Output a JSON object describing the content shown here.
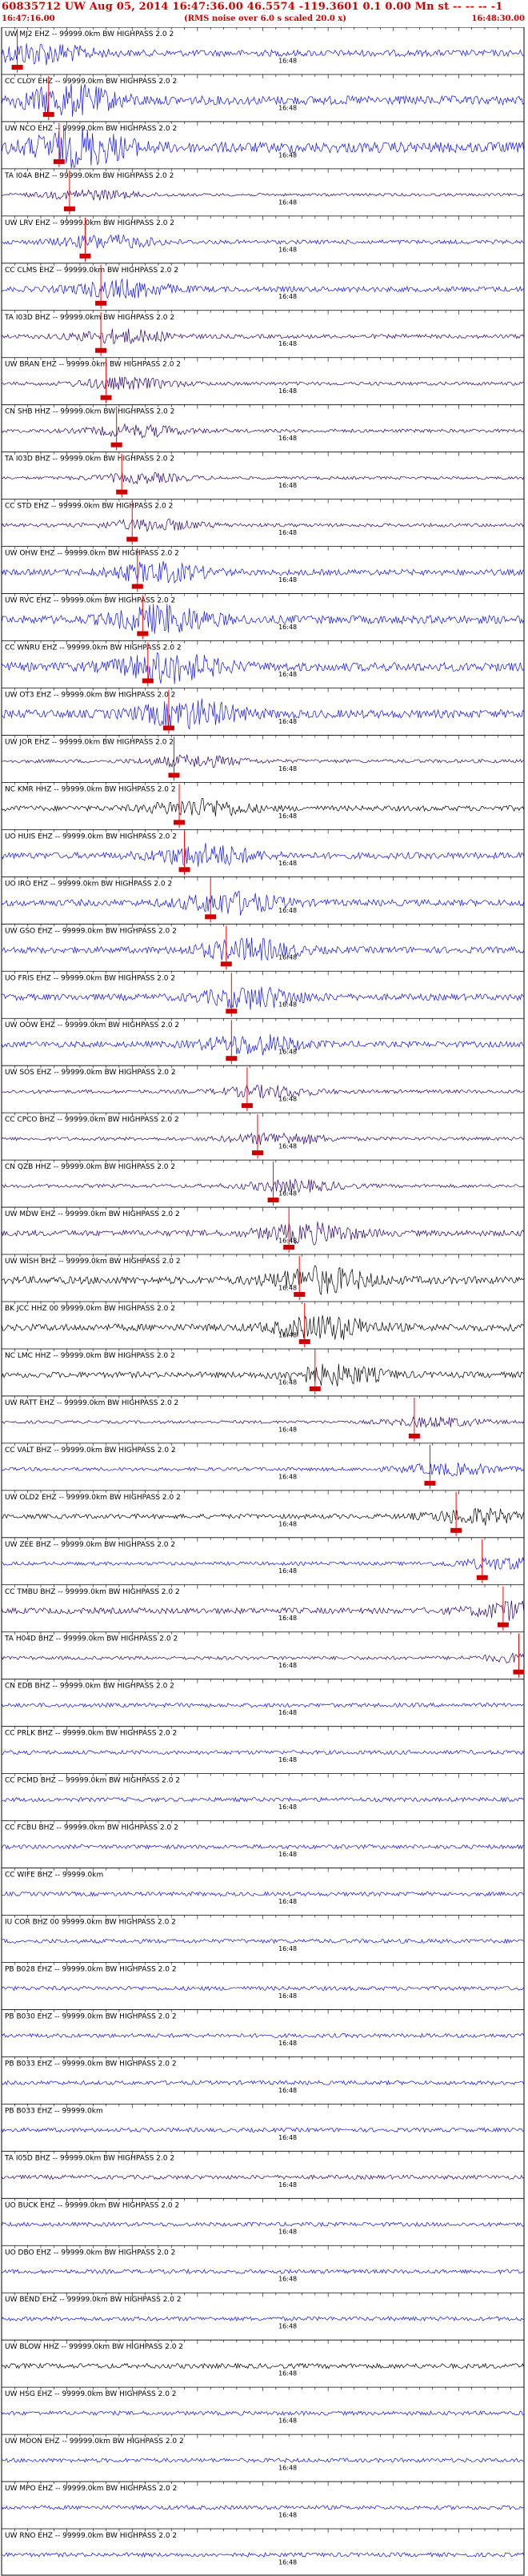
{
  "header": {
    "event_line": "60835712 UW Aug 05, 2014 16:47:36.00    46.5574 -119.3601   0.1 0.00 Mn st -- -- -- -1",
    "start_time": "16:47:16.00",
    "noise_note": "(RMS noise over 6.0 s scaled 20.0 x)",
    "end_time": "16:48:30.00"
  },
  "colors": {
    "trace_blue": "#1010ee",
    "trace_purple": "#2a0070",
    "trace_black": "#000000",
    "pick_red": "#ff0000",
    "pick_box": "#cc0000"
  },
  "chart_data": {
    "type": "line",
    "title": "60835712 UW Aug 05, 2014 16:47:36.00    46.5574 -119.3601   0.1 0.00 Mn st -- -- -- -1",
    "xlabel": "",
    "ylabel": "",
    "x_range": [
      "16:47:16.00",
      "16:48:30.00"
    ],
    "tick_label": "16:48",
    "channels": [
      {
        "name": "UW MJ2 EHZ -- 99999.0km BW  HIGHPASS  2.0  2",
        "color": "#1010ee",
        "amp": 0.55,
        "pick": 0.03
      },
      {
        "name": "CC CLOY EHZ -- 99999.0km BW  HIGHPASS  2.0  2",
        "color": "#1010ee",
        "amp": 0.75,
        "pick": 0.09
      },
      {
        "name": "UW NCO EHZ -- 99999.0km BW  HIGHPASS  2.0  2",
        "color": "#1010ee",
        "amp": 0.9,
        "pick": 0.11
      },
      {
        "name": "TA I04A BHZ -- 99999.0km BW  HIGHPASS  2.0  2",
        "color": "#2a0070",
        "amp": 0.25,
        "pick": 0.13
      },
      {
        "name": "UW LRV EHZ -- 99999.0km BW  HIGHPASS  2.0  2",
        "color": "#1010ee",
        "amp": 0.35,
        "pick": 0.16
      },
      {
        "name": "CC CLMS EHZ -- 99999.0km BW  HIGHPASS  2.0  2",
        "color": "#1010ee",
        "amp": 0.45,
        "pick": 0.19
      },
      {
        "name": "TA I03D BHZ -- 99999.0km BW  HIGHPASS  2.0  2",
        "color": "#2a0070",
        "amp": 0.35,
        "pick": 0.19
      },
      {
        "name": "UW BRAN EHZ -- 99999.0km BW  HIGHPASS  2.0  2",
        "color": "#2a0070",
        "amp": 0.3,
        "pick": 0.2
      },
      {
        "name": "CN SHB HHZ -- 99999.0km BW  HIGHPASS  2.0  2",
        "color": "#2a0070",
        "amp": 0.3,
        "pick": 0.22
      },
      {
        "name": "TA I03D BHZ -- 99999.0km BW  HIGHPASS  2.0  2",
        "color": "#2a0070",
        "amp": 0.25,
        "pick": 0.23
      },
      {
        "name": "CC STD EHZ -- 99999.0km BW  HIGHPASS  2.0  2",
        "color": "#2a0070",
        "amp": 0.3,
        "pick": 0.25
      },
      {
        "name": "UW OHW EHZ -- 99999.0km BW  HIGHPASS  2.0  2",
        "color": "#1010ee",
        "amp": 0.5,
        "pick": 0.26
      },
      {
        "name": "UW RVC EHZ -- 99999.0km BW  HIGHPASS  2.0  2",
        "color": "#1010ee",
        "amp": 0.7,
        "pick": 0.27
      },
      {
        "name": "CC WNRU EHZ -- 99999.0km BW  HIGHPASS  2.0  2",
        "color": "#1010ee",
        "amp": 0.75,
        "pick": 0.28
      },
      {
        "name": "UW OT3 EHZ -- 99999.0km BW  HIGHPASS  2.0  2",
        "color": "#1010ee",
        "amp": 0.7,
        "pick": 0.32
      },
      {
        "name": "UW JOR EHZ -- 99999.0km BW  HIGHPASS  2.0  2",
        "color": "#2a0070",
        "amp": 0.3,
        "pick": 0.33
      },
      {
        "name": "NC KMR HHZ -- 99999.0km BW  HIGHPASS  2.0  2",
        "color": "#000000",
        "amp": 0.45,
        "pick": 0.34
      },
      {
        "name": "UO HUIS EHZ -- 99999.0km BW  HIGHPASS  2.0  2",
        "color": "#1010ee",
        "amp": 0.55,
        "pick": 0.35
      },
      {
        "name": "UO IRO EHZ -- 99999.0km BW  HIGHPASS  2.0  2",
        "color": "#1010ee",
        "amp": 0.55,
        "pick": 0.4
      },
      {
        "name": "UW GSO EHZ -- 99999.0km BW  HIGHPASS  2.0  2",
        "color": "#1010ee",
        "amp": 0.55,
        "pick": 0.43
      },
      {
        "name": "UO FRIS EHZ -- 99999.0km BW  HIGHPASS  2.0  2",
        "color": "#1010ee",
        "amp": 0.55,
        "pick": 0.44
      },
      {
        "name": "UW OOW EHZ -- 99999.0km BW  HIGHPASS  2.0  2",
        "color": "#1010ee",
        "amp": 0.5,
        "pick": 0.44
      },
      {
        "name": "UW SOS EHZ -- 99999.0km BW  HIGHPASS  2.0  2",
        "color": "#2a0070",
        "amp": 0.3,
        "pick": 0.47
      },
      {
        "name": "CC CPCO BHZ -- 99999.0km BW  HIGHPASS  2.0  2",
        "color": "#2a0070",
        "amp": 0.3,
        "pick": 0.49
      },
      {
        "name": "CN QZB HHZ -- 99999.0km BW  HIGHPASS  2.0  2",
        "color": "#2a0070",
        "amp": 0.3,
        "pick": 0.52
      },
      {
        "name": "UW MDW EHZ -- 99999.0km BW  HIGHPASS  2.0  2",
        "color": "#2a0070",
        "amp": 0.5,
        "pick": 0.55
      },
      {
        "name": "UW WISH BHZ -- 99999.0km BW  HIGHPASS  2.0  2",
        "color": "#000000",
        "amp": 0.65,
        "pick": 0.57
      },
      {
        "name": "BK JCC HHZ 00 99999.0km BW  HIGHPASS  2.0  2",
        "color": "#000000",
        "amp": 0.6,
        "pick": 0.58
      },
      {
        "name": "NC LMC HHZ -- 99999.0km BW  HIGHPASS  2.0  2",
        "color": "#000000",
        "amp": 0.5,
        "pick": 0.6
      },
      {
        "name": "UW RATT EHZ -- 99999.0km BW  HIGHPASS  2.0  2",
        "color": "#2a0070",
        "amp": 0.25,
        "pick": 0.79
      },
      {
        "name": "CC VALT BHZ -- 99999.0km BW  HIGHPASS  2.0  2",
        "color": "#1010ee",
        "amp": 0.3,
        "pick": 0.82
      },
      {
        "name": "UW OLD2 EHZ -- 99999.0km BW  HIGHPASS  2.0  2",
        "color": "#000000",
        "amp": 0.4,
        "pick": 0.87
      },
      {
        "name": "UW ZEE BHZ -- 99999.0km BW  HIGHPASS  2.0  2",
        "color": "#1010ee",
        "amp": 0.3,
        "pick": 0.92
      },
      {
        "name": "CC TMBU BHZ -- 99999.0km BW  HIGHPASS  2.0  2",
        "color": "#2a0070",
        "amp": 0.5,
        "pick": 0.96
      },
      {
        "name": "TA H04D BHZ -- 99999.0km BW  HIGHPASS  2.0  2",
        "color": "#2a0070",
        "amp": 0.3,
        "pick": 0.99
      },
      {
        "name": "CN EDB BHZ -- 99999.0km BW  HIGHPASS  2.0  2",
        "color": "#1010ee",
        "amp": 0.25,
        "pick": null
      },
      {
        "name": "CC PRLK BHZ -- 99999.0km BW  HIGHPASS  2.0  2",
        "color": "#1010ee",
        "amp": 0.25,
        "pick": null
      },
      {
        "name": "CC PCMD BHZ -- 99999.0km BW  HIGHPASS  2.0  2",
        "color": "#1010ee",
        "amp": 0.25,
        "pick": null
      },
      {
        "name": "CC FCBU BHZ -- 99999.0km BW  HIGHPASS  2.0  2",
        "color": "#1010ee",
        "amp": 0.25,
        "pick": null
      },
      {
        "name": "CC WIFE BHZ -- 99999.0km",
        "color": "#1010ee",
        "amp": 0.25,
        "pick": null
      },
      {
        "name": "IU COR BHZ 00 99999.0km BW  HIGHPASS  2.0  2",
        "color": "#1010ee",
        "amp": 0.25,
        "pick": null
      },
      {
        "name": "PB B028 EHZ -- 99999.0km BW  HIGHPASS  2.0  2",
        "color": "#1010ee",
        "amp": 0.25,
        "pick": null
      },
      {
        "name": "PB B030 EHZ -- 99999.0km BW  HIGHPASS  2.0  2",
        "color": "#1010ee",
        "amp": 0.25,
        "pick": null
      },
      {
        "name": "PB B033 EHZ -- 99999.0km BW  HIGHPASS  2.0  2",
        "color": "#1010ee",
        "amp": 0.25,
        "pick": null
      },
      {
        "name": "PB B033 EHZ -- 99999.0km",
        "color": "#1010ee",
        "amp": 0.25,
        "pick": null
      },
      {
        "name": "TA I05D BHZ -- 99999.0km BW  HIGHPASS  2.0  2",
        "color": "#2a0070",
        "amp": 0.25,
        "pick": null
      },
      {
        "name": "UO BUCK EHZ -- 99999.0km BW  HIGHPASS  2.0  2",
        "color": "#1010ee",
        "amp": 0.25,
        "pick": null
      },
      {
        "name": "UO DBO EHZ -- 99999.0km BW  HIGHPASS  2.0  2",
        "color": "#1010ee",
        "amp": 0.25,
        "pick": null
      },
      {
        "name": "UW BEND EHZ -- 99999.0km BW  HIGHPASS  2.0  2",
        "color": "#1010ee",
        "amp": 0.25,
        "pick": null
      },
      {
        "name": "UW BLOW HHZ -- 99999.0km BW  HIGHPASS  2.0  2",
        "color": "#000000",
        "amp": 0.3,
        "pick": null
      },
      {
        "name": "UW HSG EHZ -- 99999.0km BW  HIGHPASS  2.0  2",
        "color": "#1010ee",
        "amp": 0.25,
        "pick": null
      },
      {
        "name": "UW MOON EHZ -- 99999.0km BW  HIGHPASS  2.0  2",
        "color": "#1010ee",
        "amp": 0.25,
        "pick": null
      },
      {
        "name": "UW MPO EHZ -- 99999.0km BW  HIGHPASS  2.0  2",
        "color": "#1010ee",
        "amp": 0.25,
        "pick": null
      },
      {
        "name": "UW RNO EHZ -- 99999.0km BW  HIGHPASS  2.0  2",
        "color": "#1010ee",
        "amp": 0.25,
        "pick": null
      }
    ]
  }
}
